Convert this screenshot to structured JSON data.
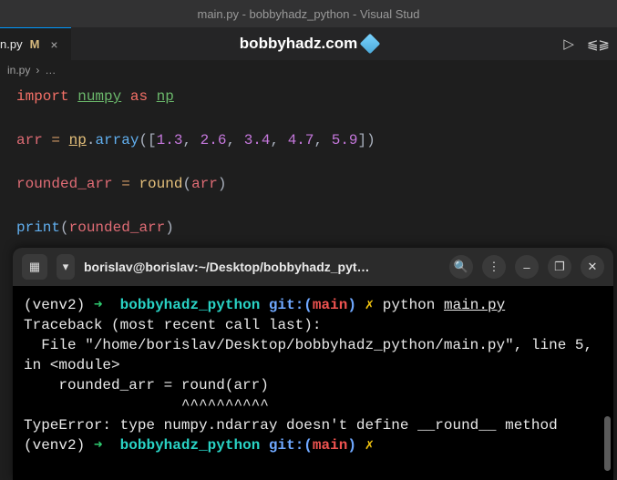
{
  "window": {
    "title": "main.py - bobbyhadz_python - Visual Stud"
  },
  "tab": {
    "name": "n.py",
    "modified_badge": "M",
    "close": "×"
  },
  "center_brand": "bobbyhadz.com",
  "run_icon": "▷",
  "split_icon": "⫹⫺",
  "breadcrumb": {
    "file": "in.py",
    "sep": "›",
    "more": "…"
  },
  "code": {
    "l1_import": "import",
    "l1_numpy": "numpy",
    "l1_as": "as",
    "l1_np": "np",
    "l3_arr": "arr",
    "l3_eq": " = ",
    "l3_np": "np",
    "l3_dot": ".",
    "l3_array": "array",
    "l3_open": "([",
    "l3_n1": "1.3",
    "l3_c": ", ",
    "l3_n2": "2.6",
    "l3_n3": "3.4",
    "l3_n4": "4.7",
    "l3_n5": "5.9",
    "l3_close": "])",
    "l5_rarr": "rounded_arr",
    "l5_eq": " = ",
    "l5_round": "round",
    "l5_open": "(",
    "l5_arg": "arr",
    "l5_close": ")",
    "l7_print": "print",
    "l7_open": "(",
    "l7_arg": "rounded_arr",
    "l7_close": ")"
  },
  "terminal": {
    "header": {
      "new_tab": "▦",
      "dropdown": "▾",
      "title": "borislav@borislav:~/Desktop/bobbyhadz_pyt…",
      "search": "🔍",
      "menu": "⋮",
      "min": "–",
      "max": "❐",
      "close": "✕"
    },
    "p1_venv": "(venv2)",
    "p1_arrow": " ➜ ",
    "p1_dir": " bobbyhadz_python",
    "p1_git": " git:(",
    "p1_branch": "main",
    "p1_gitclose": ")",
    "p1_x": " ✗",
    "p1_cmd": " python ",
    "p1_file": "main.py",
    "trace1": "Traceback (most recent call last):",
    "trace2": "  File \"/home/borislav/Desktop/bobbyhadz_python/main.py\", line 5, in <module>",
    "trace3": "    rounded_arr = round(arr)",
    "trace4": "                  ^^^^^^^^^^",
    "trace5": "TypeError: type numpy.ndarray doesn't define __round__ method",
    "p2_venv": "(venv2)",
    "p2_arrow": " ➜ ",
    "p2_dir": " bobbyhadz_python",
    "p2_git": " git:(",
    "p2_branch": "main",
    "p2_gitclose": ")",
    "p2_x": " ✗"
  }
}
